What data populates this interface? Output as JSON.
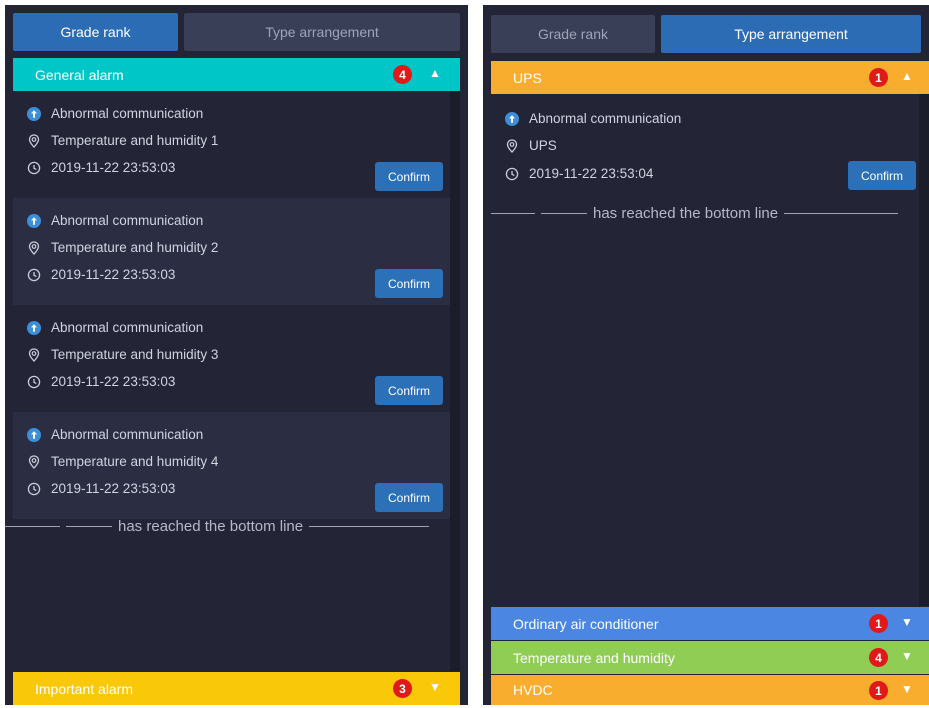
{
  "tabs": {
    "grade": "Grade rank",
    "type": "Type arrangement"
  },
  "colors": {
    "panel_bg": "#232536",
    "tab_active": "#2b6cb5",
    "general_alarm": "#00c6c8",
    "important_alarm": "#f9c809",
    "ups": "#f8ad2f",
    "ordinary_air": "#4a86e2",
    "temperature_humidity": "#8fcd55",
    "hvdc": "#f8ad2f",
    "badge": "#e01919",
    "confirm": "#2c70b8"
  },
  "left": {
    "general_alarm": {
      "label": "General alarm",
      "count": "4"
    },
    "important_alarm": {
      "label": "Important alarm",
      "count": "3"
    },
    "alarms": [
      {
        "type": "Abnormal communication",
        "location": "Temperature and humidity 1",
        "time": "2019-11-22 23:53:03",
        "button": "Confirm"
      },
      {
        "type": "Abnormal communication",
        "location": "Temperature and humidity 2",
        "time": "2019-11-22 23:53:03",
        "button": "Confirm"
      },
      {
        "type": "Abnormal communication",
        "location": "Temperature and humidity 3",
        "time": "2019-11-22 23:53:03",
        "button": "Confirm"
      },
      {
        "type": "Abnormal communication",
        "location": "Temperature and humidity 4",
        "time": "2019-11-22 23:53:03",
        "button": "Confirm"
      }
    ],
    "bottom_line": "has reached the bottom line"
  },
  "right": {
    "ups": {
      "label": "UPS",
      "count": "1"
    },
    "alarms": [
      {
        "type": "Abnormal communication",
        "location": "UPS",
        "time": "2019-11-22 23:53:04",
        "button": "Confirm"
      }
    ],
    "bottom_line": "has reached the bottom line",
    "ordinary_air": {
      "label": "Ordinary air conditioner",
      "count": "1"
    },
    "temperature_humidity": {
      "label": "Temperature and humidity",
      "count": "4"
    },
    "hvdc": {
      "label": "HVDC",
      "count": "1"
    }
  },
  "icons": {
    "type": "arrow-up-circle-icon",
    "location": "location-pin-icon",
    "time": "clock-icon",
    "expand": "caret-up-icon",
    "collapse": "caret-down-icon"
  }
}
